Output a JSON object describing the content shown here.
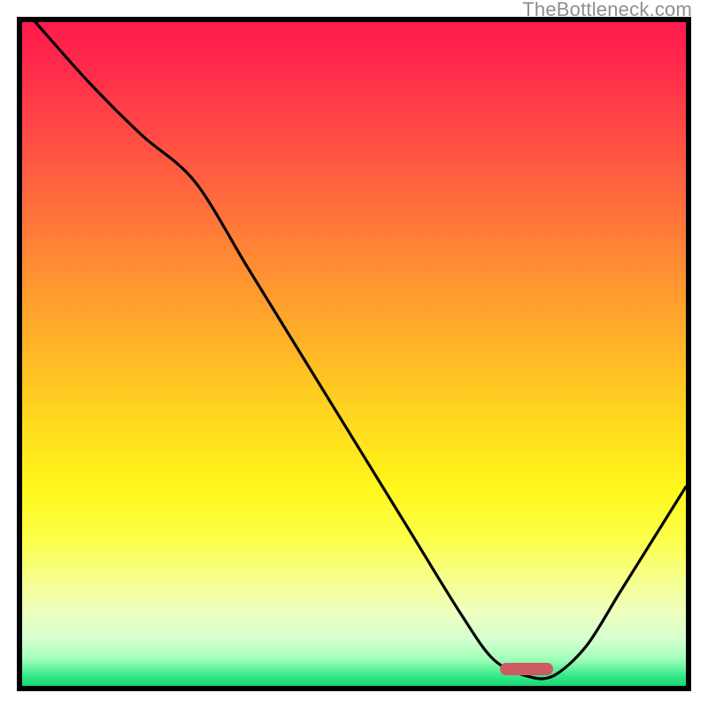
{
  "watermark": "TheBottleneck.com",
  "marker": {
    "left_frac": 0.72,
    "width_frac": 0.08,
    "y_frac": 0.974
  },
  "chart_data": {
    "type": "line",
    "title": "",
    "xlabel": "",
    "ylabel": "",
    "xlim": [
      0,
      1
    ],
    "ylim": [
      0,
      1
    ],
    "series": [
      {
        "name": "curve",
        "x": [
          0.02,
          0.1,
          0.18,
          0.26,
          0.34,
          0.42,
          0.5,
          0.58,
          0.66,
          0.71,
          0.76,
          0.8,
          0.85,
          0.9,
          0.95,
          1.0
        ],
        "y": [
          1.0,
          0.91,
          0.83,
          0.76,
          0.63,
          0.5,
          0.37,
          0.24,
          0.11,
          0.04,
          0.015,
          0.015,
          0.06,
          0.14,
          0.22,
          0.3
        ]
      }
    ],
    "gradient_stops": [
      {
        "pos": 0.0,
        "color": "#ff1a4d"
      },
      {
        "pos": 0.2,
        "color": "#ff5542"
      },
      {
        "pos": 0.48,
        "color": "#ffb128"
      },
      {
        "pos": 0.7,
        "color": "#fff71a"
      },
      {
        "pos": 0.89,
        "color": "#ecffbf"
      },
      {
        "pos": 1.0,
        "color": "#17d673"
      }
    ]
  }
}
